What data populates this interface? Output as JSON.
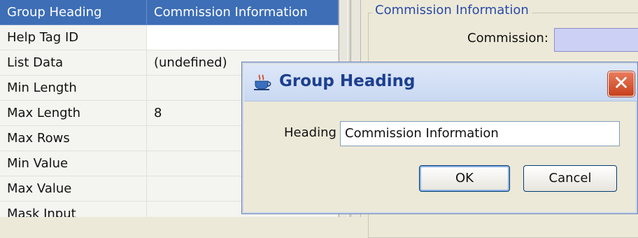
{
  "property_sheet": {
    "rows": [
      {
        "name": "Group Heading",
        "value": "Commission Information",
        "selected": true
      },
      {
        "name": "Help Tag ID",
        "value": "",
        "white": true
      },
      {
        "name": "List Data",
        "value": "(undefined)"
      },
      {
        "name": "Min Length",
        "value": ""
      },
      {
        "name": "Max Length",
        "value": "8"
      },
      {
        "name": "Max Rows",
        "value": ""
      },
      {
        "name": "Min Value",
        "value": ""
      },
      {
        "name": "Max Value",
        "value": ""
      },
      {
        "name": "Mask Input",
        "value": ""
      }
    ]
  },
  "preview": {
    "group_title": "Commission Information",
    "commission_label": "Commission:",
    "commission_field_color": "#cdd0f5"
  },
  "dialog": {
    "title": "Group Heading",
    "title_icon": "java-cup-icon",
    "close_icon": "close-icon",
    "heading_label": "Heading",
    "heading_value": "Commission Information",
    "ok_label": "OK",
    "cancel_label": "Cancel",
    "close_button_color": "#d8532c"
  }
}
